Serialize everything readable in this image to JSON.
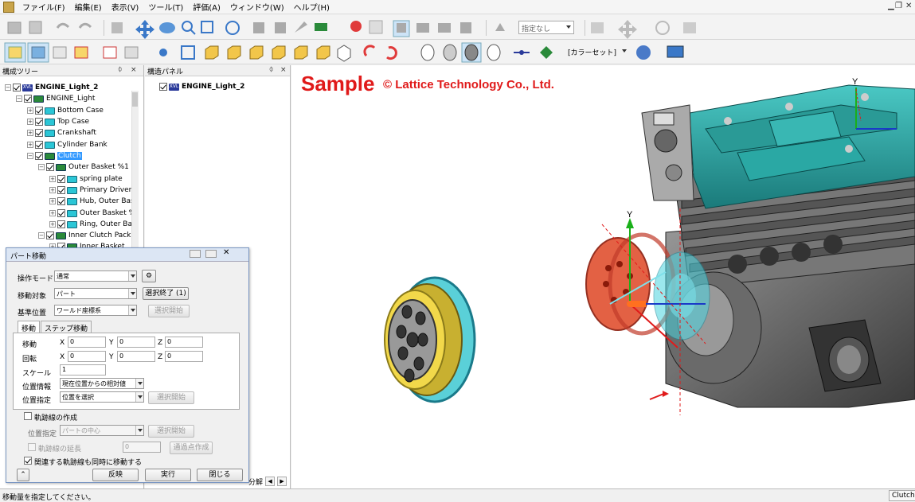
{
  "menu": [
    "ファイル(F)",
    "編集(E)",
    "表示(V)",
    "ツール(T)",
    "評価(A)",
    "ウィンドウ(W)",
    "ヘルプ(H)"
  ],
  "toolbar": {
    "selection_mode": "指定なし",
    "color_set": "[カラーセット]"
  },
  "tree_panel": {
    "title": "構成ツリー",
    "pin": "ᛰ",
    "close": "×",
    "items": [
      {
        "label": "ENGINE_Light_2",
        "bold": true
      },
      {
        "label": "ENGINE_Light"
      },
      {
        "label": "Bottom Case"
      },
      {
        "label": "Top Case"
      },
      {
        "label": "Crankshaft"
      },
      {
        "label": "Cylinder Bank"
      },
      {
        "label": "Clutch"
      },
      {
        "label": "Outer Basket %1"
      },
      {
        "label": "spring plate"
      },
      {
        "label": "Primary Driven"
      },
      {
        "label": "Hub, Outer Bask"
      },
      {
        "label": "Outer Basket %"
      },
      {
        "label": "Ring, Outer Bas"
      },
      {
        "label": "Inner Clutch Pack ("
      },
      {
        "label": "Inner Basket"
      }
    ]
  },
  "struct_panel": {
    "title": "構造パネル",
    "pin": "ᛰ",
    "close": "×",
    "root": "ENGINE_Light_2"
  },
  "viewport": {
    "watermark_sample": "Sample",
    "watermark_company": "© Lattice Technology Co., Ltd.",
    "axis_y": "Y",
    "axis_y2": "Y"
  },
  "dialog": {
    "title": "パート移動",
    "operation_mode_label": "操作モード",
    "operation_mode": "通常",
    "move_target_label": "移動対象",
    "move_target": "パート",
    "end_selection": "選択終了 (1)",
    "base_position_label": "基準位置",
    "base_position": "ワールド座標系",
    "start_selection": "選択開始",
    "tab_move": "移動",
    "tab_step": "ステップ移動",
    "translate_label": "移動",
    "rotate_label": "回転",
    "scale_label": "スケール",
    "x": "X",
    "y": "Y",
    "z": "Z",
    "tx": "0",
    "ty": "0",
    "tz": "0",
    "rx": "0",
    "ry": "0",
    "rz": "0",
    "scale": "1",
    "position_info_label": "位置情報",
    "position_info": "現在位置からの相対値",
    "position_spec_label": "位置指定",
    "position_spec": "位置を選択",
    "start_selection2": "選択開始",
    "trajectory_create": "軌跡線の作成",
    "position_spec2_label": "位置指定",
    "position_spec2": "パートの中心",
    "start_selection3": "選択開始",
    "trajectory_extend": "軌跡線の延長",
    "extend_value": "0",
    "waypoint_create": "通過点作成",
    "move_related": "関連する軌跡線も同時に移動する",
    "reflect": "反映",
    "execute": "実行",
    "close": "閉じる"
  },
  "status": {
    "message": "移動量を指定してください。",
    "selection": "Clutch"
  },
  "bottom_tab": "分解"
}
